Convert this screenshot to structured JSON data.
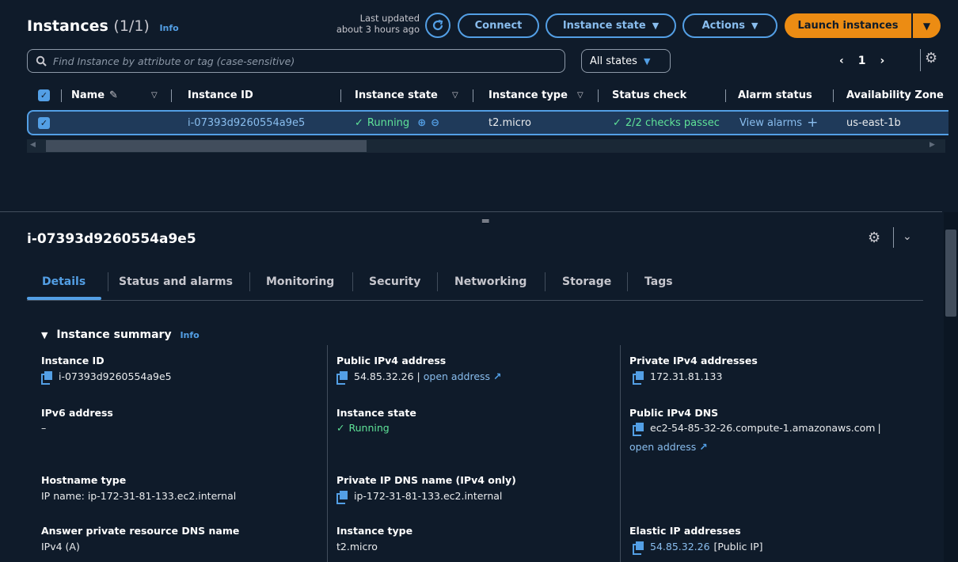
{
  "header": {
    "title": "Instances",
    "count": "(1/1)",
    "info": "Info",
    "last_updated_line1": "Last updated",
    "last_updated_line2": "about 3 hours ago",
    "connect": "Connect",
    "instance_state": "Instance state",
    "actions": "Actions",
    "launch": "Launch instances"
  },
  "filter": {
    "search_placeholder": "Find Instance by attribute or tag (case-sensitive)",
    "states": "All states",
    "page": "1"
  },
  "table": {
    "columns": [
      "Name",
      "Instance ID",
      "Instance state",
      "Instance type",
      "Status check",
      "Alarm status",
      "Availability Zone"
    ],
    "row": {
      "name": "",
      "instance_id": "i-07393d9260554a9e5",
      "state": "Running",
      "type": "t2.micro",
      "status_check": "2/2 checks passec",
      "alarm": "View alarms",
      "az": "us-east-1b"
    }
  },
  "detail": {
    "title": "i-07393d9260554a9e5",
    "tabs": [
      "Details",
      "Status and alarms",
      "Monitoring",
      "Security",
      "Networking",
      "Storage",
      "Tags"
    ],
    "summary_title": "Instance summary",
    "summary_info": "Info",
    "fields": {
      "instance_id_label": "Instance ID",
      "instance_id": "i-07393d9260554a9e5",
      "public_ipv4_label": "Public IPv4 address",
      "public_ipv4": "54.85.32.26",
      "open_address": "open address",
      "private_ipv4_label": "Private IPv4 addresses",
      "private_ipv4": "172.31.81.133",
      "ipv6_label": "IPv6 address",
      "ipv6": "–",
      "instance_state_label": "Instance state",
      "instance_state": "Running",
      "public_dns_label": "Public IPv4 DNS",
      "public_dns": "ec2-54-85-32-26.compute-1.amazonaws.com",
      "public_dns_open": "open address",
      "hostname_type_label": "Hostname type",
      "hostname_type": "IP name: ip-172-31-81-133.ec2.internal",
      "private_dns_label": "Private IP DNS name (IPv4 only)",
      "private_dns": "ip-172-31-81-133.ec2.internal",
      "answer_dns_label": "Answer private resource DNS name",
      "answer_dns": "IPv4 (A)",
      "instance_type_label": "Instance type",
      "instance_type": "t2.micro",
      "elastic_ip_label": "Elastic IP addresses",
      "elastic_ip": "54.85.32.26",
      "elastic_ip_suffix": "[Public IP]"
    }
  },
  "colors": {
    "background": "#0f1b2a",
    "accent": "#539fe5",
    "primary": "#ec8c13",
    "success": "#5fe398"
  }
}
